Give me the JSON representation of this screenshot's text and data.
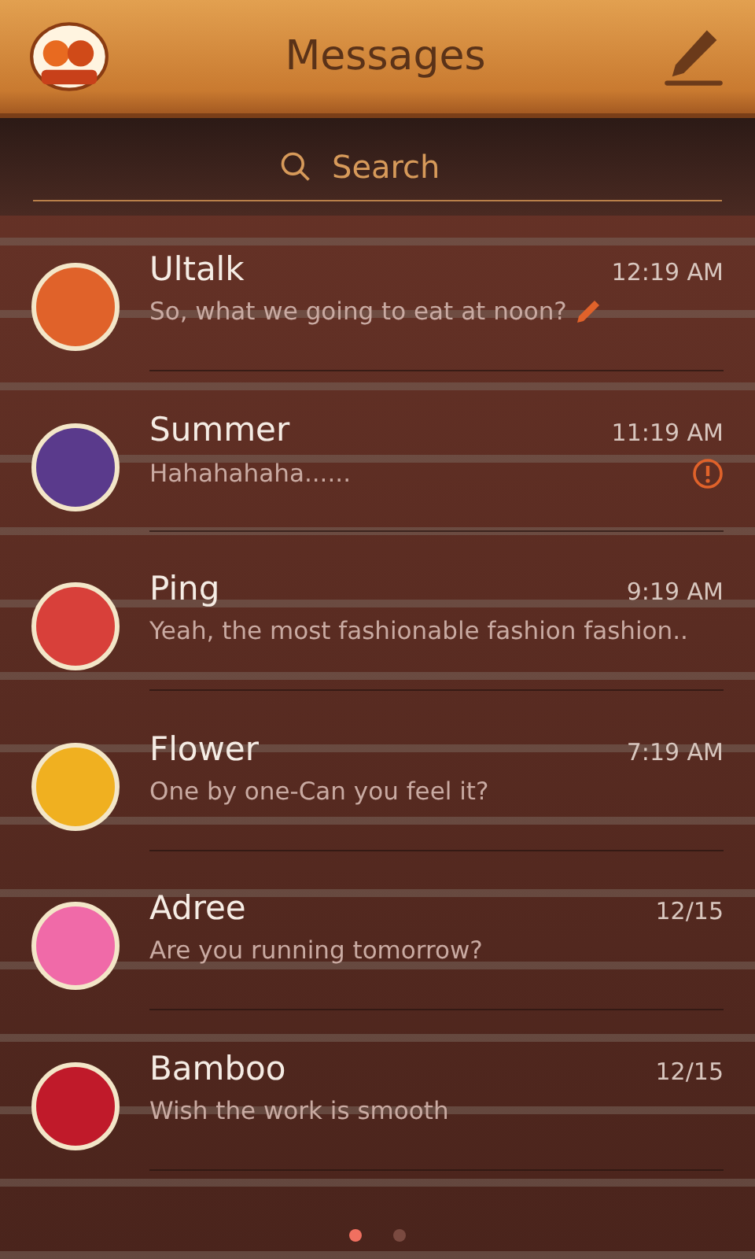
{
  "header": {
    "title": "Messages"
  },
  "search": {
    "placeholder": "Search"
  },
  "conversations": [
    {
      "name": "Ultalk",
      "time": "12:19 AM",
      "preview": "So, what we going to eat at noon?",
      "draft": true,
      "failed": false,
      "color": "#e0622a"
    },
    {
      "name": "Summer",
      "time": "11:19 AM",
      "preview": "Hahahahaha......",
      "draft": false,
      "failed": true,
      "color": "#5a3a8c"
    },
    {
      "name": "Ping",
      "time": "9:19 AM",
      "preview": "Yeah, the most fashionable fashion fashion..",
      "draft": false,
      "failed": false,
      "color": "#d8403a"
    },
    {
      "name": "Flower",
      "time": "7:19 AM",
      "preview": "One by one-Can you feel it?",
      "draft": false,
      "failed": false,
      "color": "#f0b020"
    },
    {
      "name": "Adree",
      "time": "12/15",
      "preview": "Are you running tomorrow?",
      "draft": false,
      "failed": false,
      "color": "#f06aa8"
    },
    {
      "name": "Bamboo",
      "time": "12/15",
      "preview": "Wish the work is smooth",
      "draft": false,
      "failed": false,
      "color": "#c01a2a"
    }
  ],
  "pages": [
    {
      "selected": true
    },
    {
      "selected": false
    }
  ]
}
